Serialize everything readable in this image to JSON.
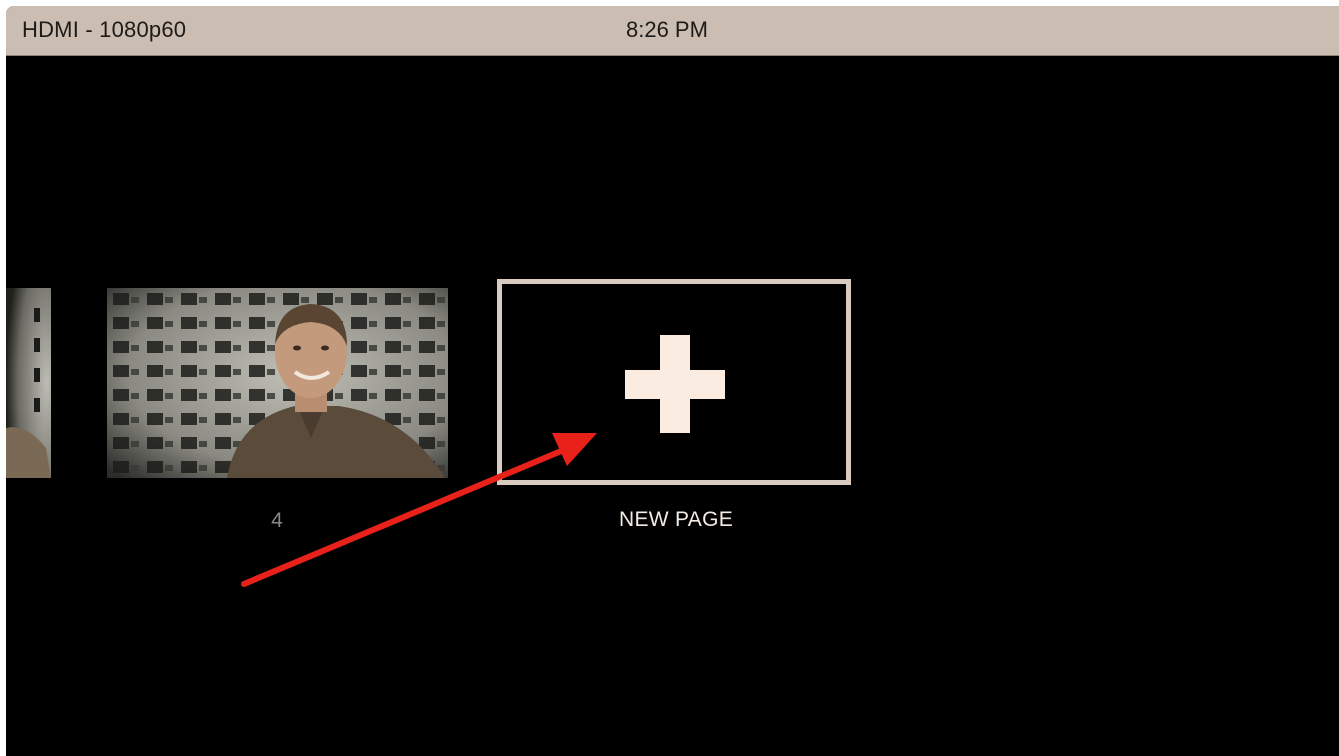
{
  "status_bar": {
    "input_format": "HDMI - 1080p60",
    "time": "8:26 PM"
  },
  "pages": {
    "thumbnails": [
      {
        "label": ""
      },
      {
        "label": "4"
      }
    ],
    "new_page": {
      "label": "NEW PAGE",
      "icon": "plus-icon"
    }
  },
  "annotation": {
    "arrow_color": "#e8221b"
  },
  "colors": {
    "status_bar_bg": "#cbbdb1",
    "screen_bg": "#000000",
    "tile_border": "#d9cbc0",
    "plus_color": "#fbece2"
  }
}
